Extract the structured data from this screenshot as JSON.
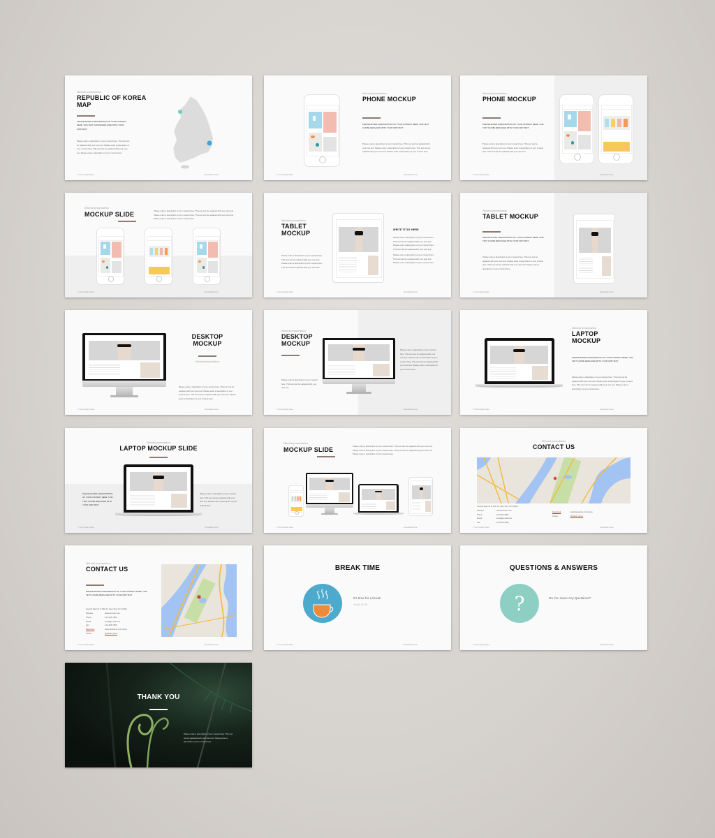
{
  "colors": {
    "background": "#d9d5d1",
    "slide": "#fafafa",
    "accent_divider": "#8b7b71",
    "break_circle": "#4eaacc",
    "qa_circle": "#8ecfc4",
    "link": "#c0392b"
  },
  "common": {
    "subtitle": "Minimal presentation",
    "footer_left": "© Your Company Name",
    "footer_right": "Presentation Name"
  },
  "slides": [
    {
      "title": "REPUBLIC OF KOREA MAP",
      "caps": "Please enter a description of your content here. This text can be replaced with your own text.",
      "body": "Please enter a description of your content here. This text can be replaced with your own text. Please enter a description of your content here. This text can be replaced with your own text. Please enter a description of your content here."
    },
    {
      "title": "PHONE MOCKUP",
      "caps": "Please enter a description of your content here. This text can be replaced with your own text.",
      "body": "Please enter a description of your content here. This text can be replaced with your own text. Please enter a description of your content here. This text can be replaced with your own text. Please enter a description of your content here."
    },
    {
      "title": "PHONE MOCKUP",
      "caps": "Please enter a description of your content here. This text can be replaced with your own text.",
      "body": "Please enter a description of your content here. This text can be replaced with your own text. Please enter a description of your content here. This text can be replaced with your own text."
    },
    {
      "title": "MOCKUP SLIDE",
      "body": "Please enter a description of your content here. This text can be replaced with your own text. Please enter a description of your content here. This text can be replaced with your own text. Please enter a description of your content here."
    },
    {
      "title": "TABLET MOCKUP",
      "body": "Please enter a description of your content here. This text can be replaced with your own text. Please enter a description of your content here. This text can be replaced with your own text.",
      "side_title": "WRITE TITLE HERE",
      "side_body_1": "Please enter a description of your content here. This text can be replaced with your own text. Please enter a description of your content here. This text can be replaced with your own text.",
      "side_body_2": "Please enter a description of your content here. This text can be replaced with your own text. Please enter a description of your content here."
    },
    {
      "title": "TABLET MOCKUP",
      "caps": "Please enter a description of your content here. This text can be replaced with your own text.",
      "body": "Please enter a description of your content here. This text can be replaced with your own text. Please enter a description of your content here. This text can be replaced with your own text. Please enter a description of your content here."
    },
    {
      "title": "DESKTOP MOCKUP",
      "body": "Please enter a description of your content here. This text can be replaced with your own text. Please enter a description of your content here. This text can be replaced with your own text. Please enter a description of your content here."
    },
    {
      "title": "DESKTOP MOCKUP",
      "body": "Please enter a description of your content here. This text can be replaced with your own text.",
      "side_body": "Please enter a description of your content here. This text can be replaced with your own text. Please enter a description of your content here. This text can be replaced with your own text. Please enter a description of your content here."
    },
    {
      "title": "LAPTOP MOCKUP",
      "caps": "Please enter a description of your content here. This text can be replaced with your own text.",
      "body": "Please enter a description of your content here. This text can be replaced with your own text. Please enter a description of your content here. This text can be replaced with your own text. Please enter a description of your content here."
    },
    {
      "title": "LAPTOP MOCKUP SLIDE",
      "caps": "Please enter a description of your content here. This text can be replaced with your own text.",
      "body": "Please enter a description of your content here. This text can be replaced with your own text. Please enter a description of your content here."
    },
    {
      "title": "MOCKUP SLIDE",
      "body": "Please enter a description of your content here. This text can be replaced with your own text. Please enter a description of your content here. This text can be replaced with your own text. Please enter a description of your content here."
    },
    {
      "title": "CONTACT US",
      "address": "Central Park W & 79th St, New York, NY 10024",
      "rows": [
        {
          "label": "Website",
          "value": "www.domain.com"
        },
        {
          "label": "Phone",
          "value": "123-456-7890"
        },
        {
          "label": "Email",
          "value": "email@email.com"
        },
        {
          "label": "Fax",
          "value": "123-456-7890"
        }
      ],
      "social": [
        {
          "label": "Facebook",
          "value": "www.facebook.com/name"
        },
        {
          "label": "Twitter",
          "value": "@twitter.name"
        }
      ]
    },
    {
      "title": "CONTACT US",
      "caps": "Please enter a description of your content here. This text can be replaced with your own text.",
      "address": "Central Park W & 79th St, New York, NY 10024",
      "rows": [
        {
          "label": "Website",
          "value": "www.domain.com"
        },
        {
          "label": "Phone",
          "value": "123-456-7890"
        },
        {
          "label": "Email",
          "value": "email@email.com"
        },
        {
          "label": "Fax",
          "value": "123-456-7890"
        },
        {
          "label": "Facebook",
          "value": "www.facebook.com/name"
        },
        {
          "label": "Twitter",
          "value": "@twitter.name"
        }
      ]
    },
    {
      "title": "BREAK TIME",
      "line1": "It's time for a break",
      "line2": "10:40–11:00",
      "icon": "coffee-cup-icon"
    },
    {
      "title": "QUESTIONS & ANSWERS",
      "line1": "Do You Have Any Questions?",
      "icon": "question-mark-icon"
    },
    {
      "title": "THANK YOU",
      "body": "Please enter a description of your content here. This text can be replaced with your own text. Please enter a description of your content here."
    }
  ]
}
